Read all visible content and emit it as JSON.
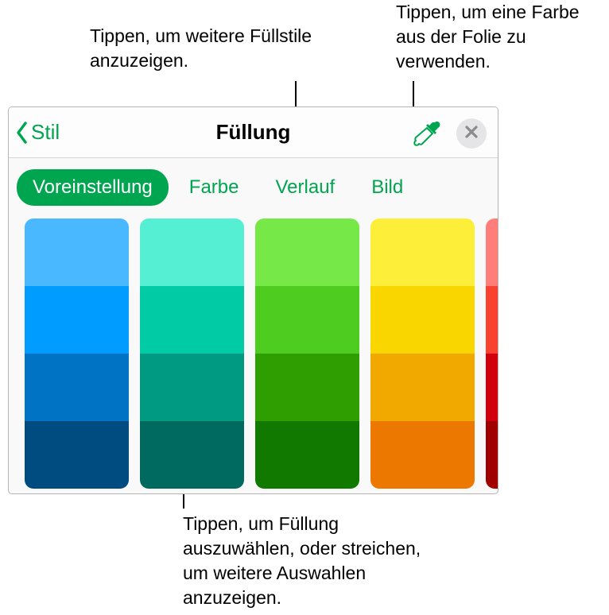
{
  "callouts": {
    "tabs_hint": "Tippen, um weitere Füllstile anzuzeigen.",
    "eyedropper_hint": "Tippen, um eine Farbe aus der Folie zu verwenden.",
    "swatch_hint": "Tippen, um Füllung auszuwählen, oder streichen, um weitere Auswahlen anzuzeigen."
  },
  "header": {
    "back_label": "Stil",
    "title": "Füllung"
  },
  "tabs": {
    "preset": "Voreinstellung",
    "color": "Farbe",
    "gradient": "Verlauf",
    "image": "Bild"
  },
  "swatch_columns": [
    [
      "#4ab8ff",
      "#009cff",
      "#0073c4",
      "#004c80"
    ],
    [
      "#55f0d4",
      "#00cba5",
      "#009981",
      "#006a60"
    ],
    [
      "#76e847",
      "#4ecc20",
      "#2f9e00",
      "#117800"
    ],
    [
      "#fdee3a",
      "#f9d600",
      "#f1a900",
      "#ec7800"
    ],
    [
      "#ff7e7a",
      "#f9412f",
      "#d1000c",
      "#a10000"
    ]
  ],
  "accent_color": "#00a550"
}
